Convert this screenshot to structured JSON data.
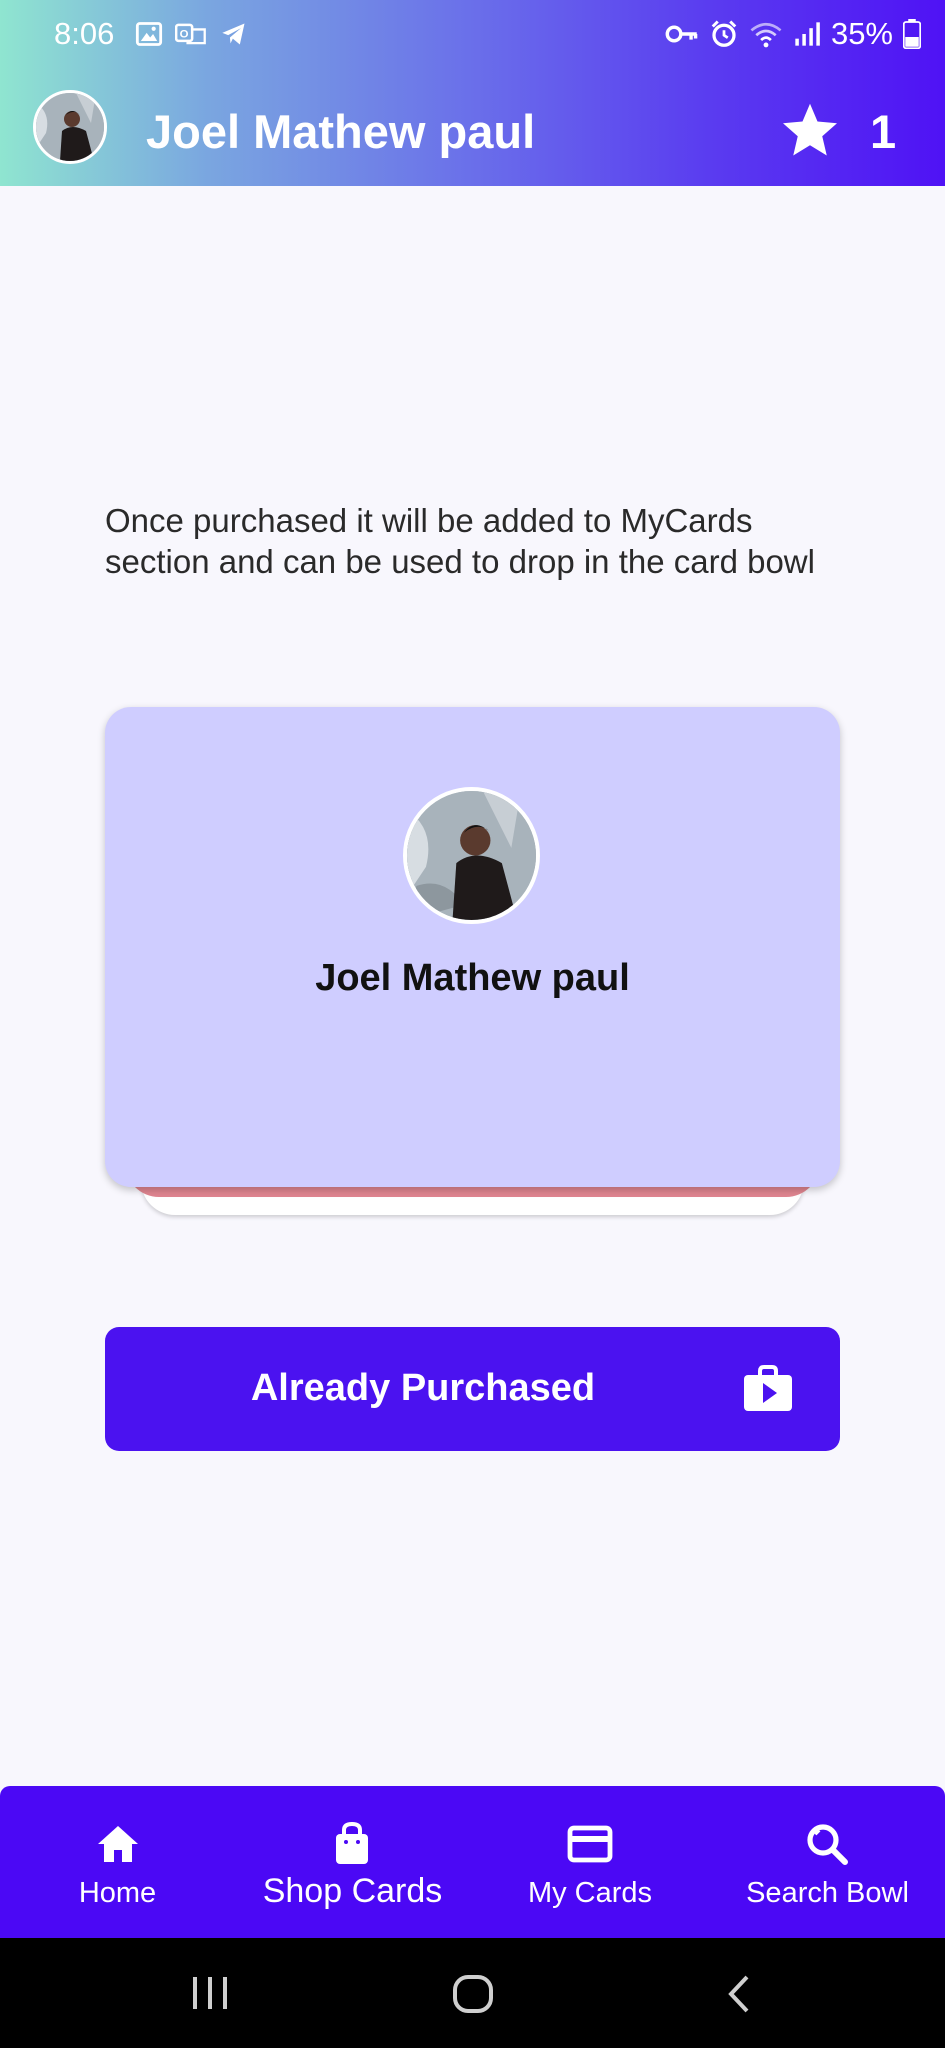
{
  "status_bar": {
    "time": "8:06",
    "battery": "35%"
  },
  "header": {
    "title": "Joel Mathew paul",
    "star_count": "1"
  },
  "main": {
    "description": "Once purchased it will be added to MyCards section and can be used to drop in the card bowl",
    "card": {
      "name": "Joel Mathew paul"
    },
    "purchase_button": {
      "label": "Already Purchased"
    }
  },
  "bottom_nav": {
    "items": [
      {
        "label": "Home",
        "icon": "home-icon"
      },
      {
        "label": "Shop Cards",
        "icon": "shopping-bag-icon"
      },
      {
        "label": "My Cards",
        "icon": "credit-card-icon"
      },
      {
        "label": "Search Bowl",
        "icon": "search-icon"
      }
    ]
  },
  "colors": {
    "accent": "#4b12f0",
    "card_background": "#cfcdff",
    "card_back": "#e08590"
  }
}
